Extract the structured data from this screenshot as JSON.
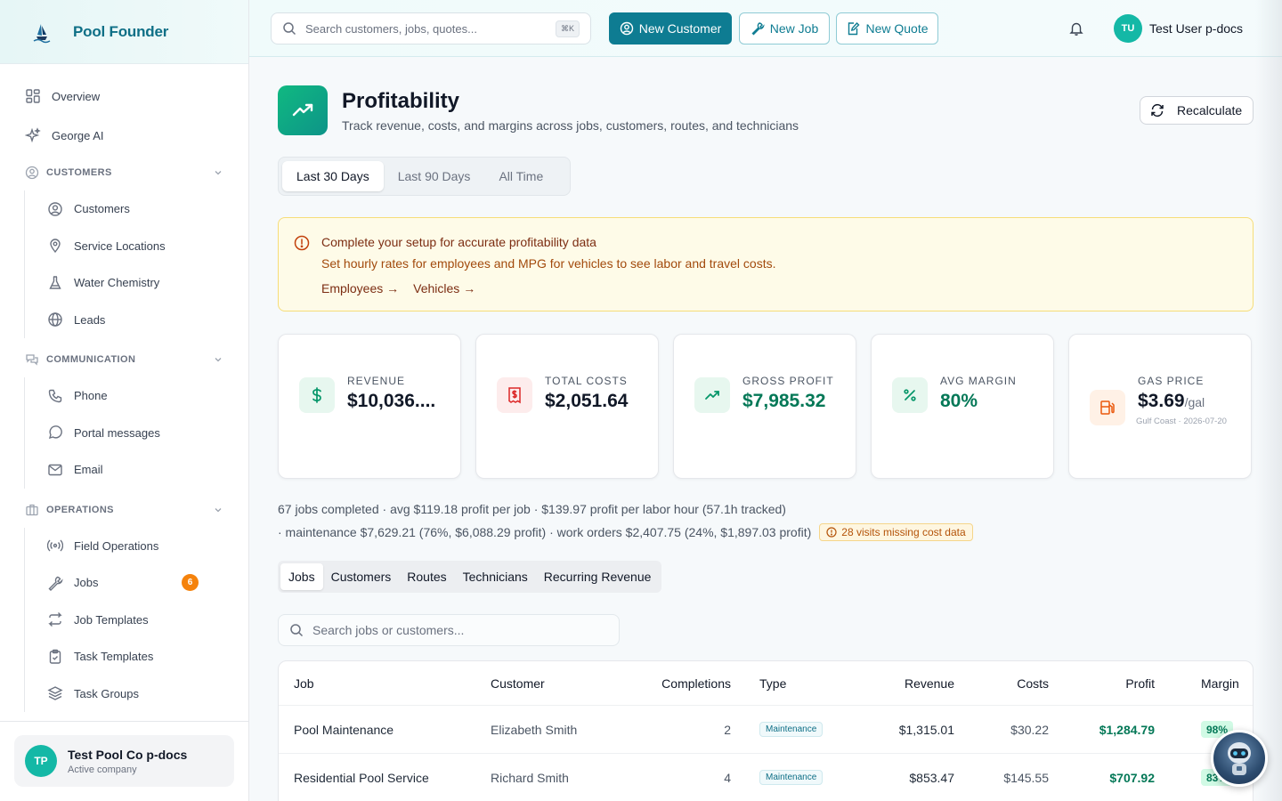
{
  "app": {
    "name": "Pool Founder"
  },
  "sidebar": {
    "top": [
      {
        "label": "Overview",
        "icon": "grid-icon"
      },
      {
        "label": "George AI",
        "icon": "sparkles-icon"
      }
    ],
    "sections": [
      {
        "title": "CUSTOMERS",
        "items": [
          {
            "label": "Customers"
          },
          {
            "label": "Service Locations"
          },
          {
            "label": "Water Chemistry"
          },
          {
            "label": "Leads"
          }
        ]
      },
      {
        "title": "COMMUNICATION",
        "items": [
          {
            "label": "Phone"
          },
          {
            "label": "Portal messages"
          },
          {
            "label": "Email"
          }
        ]
      },
      {
        "title": "OPERATIONS",
        "items": [
          {
            "label": "Field Operations"
          },
          {
            "label": "Jobs",
            "badge": "6"
          },
          {
            "label": "Job Templates"
          },
          {
            "label": "Task Templates"
          },
          {
            "label": "Task Groups"
          }
        ]
      }
    ],
    "company": {
      "initials": "TP",
      "name": "Test Pool Co p-docs",
      "status": "Active company"
    }
  },
  "topbar": {
    "search_placeholder": "Search customers, jobs, quotes...",
    "shortcut": "⌘K",
    "new_customer": "New Customer",
    "new_job": "New Job",
    "new_quote": "New Quote",
    "user_initials": "TU",
    "user_name": "Test User p-docs"
  },
  "page": {
    "title": "Profitability",
    "subtitle": "Track revenue, costs, and margins across jobs, customers, routes, and technicians",
    "recalculate": "Recalculate",
    "periods": [
      "Last 30 Days",
      "Last 90 Days",
      "All Time"
    ],
    "active_period": "Last 30 Days"
  },
  "alert": {
    "title": "Complete your setup for accurate profitability data",
    "body": "Set hourly rates for employees and MPG for vehicles to see labor and travel costs.",
    "link1": "Employees →",
    "link2": "Vehicles →"
  },
  "stats": {
    "revenue": {
      "label": "REVENUE",
      "value": "$10,036...."
    },
    "costs": {
      "label": "TOTAL COSTS",
      "value": "$2,051.64"
    },
    "profit": {
      "label": "GROSS PROFIT",
      "value": "$7,985.32"
    },
    "margin": {
      "label": "AVG MARGIN",
      "value": "80%"
    },
    "gas": {
      "label": "GAS PRICE",
      "value": "$3.69",
      "unit": "/gal",
      "note": "Gulf Coast · 2026-07-20"
    }
  },
  "summary": {
    "line1": "67 jobs completed · avg $119.18 profit per job  · $139.97 profit per labor hour (57.1h tracked)",
    "line2": "· maintenance $7,629.21 (76%, $6,088.29 profit) · work orders $2,407.75 (24%, $1,897.03 profit)",
    "missing": "28 visits missing cost data"
  },
  "tabs": [
    "Jobs",
    "Customers",
    "Routes",
    "Technicians",
    "Recurring Revenue"
  ],
  "table": {
    "search_placeholder": "Search jobs or customers...",
    "headers": {
      "job": "Job",
      "customer": "Customer",
      "completions": "Completions",
      "type": "Type",
      "revenue": "Revenue",
      "costs": "Costs",
      "profit": "Profit",
      "margin": "Margin"
    },
    "rows": [
      {
        "job": "Pool Maintenance",
        "customer": "Elizabeth Smith",
        "completions": "2",
        "type": "Maintenance",
        "revenue": "$1,315.01",
        "costs": "$30.22",
        "profit": "$1,284.79",
        "margin": "98%"
      },
      {
        "job": "Residential Pool Service",
        "customer": "Richard Smith",
        "completions": "4",
        "type": "Maintenance",
        "revenue": "$853.47",
        "costs": "$145.55",
        "profit": "$707.92",
        "margin": "83%"
      }
    ]
  },
  "colors": {
    "accent": "#0e7c92",
    "profit": "#047857",
    "warning": "#f5820b"
  }
}
